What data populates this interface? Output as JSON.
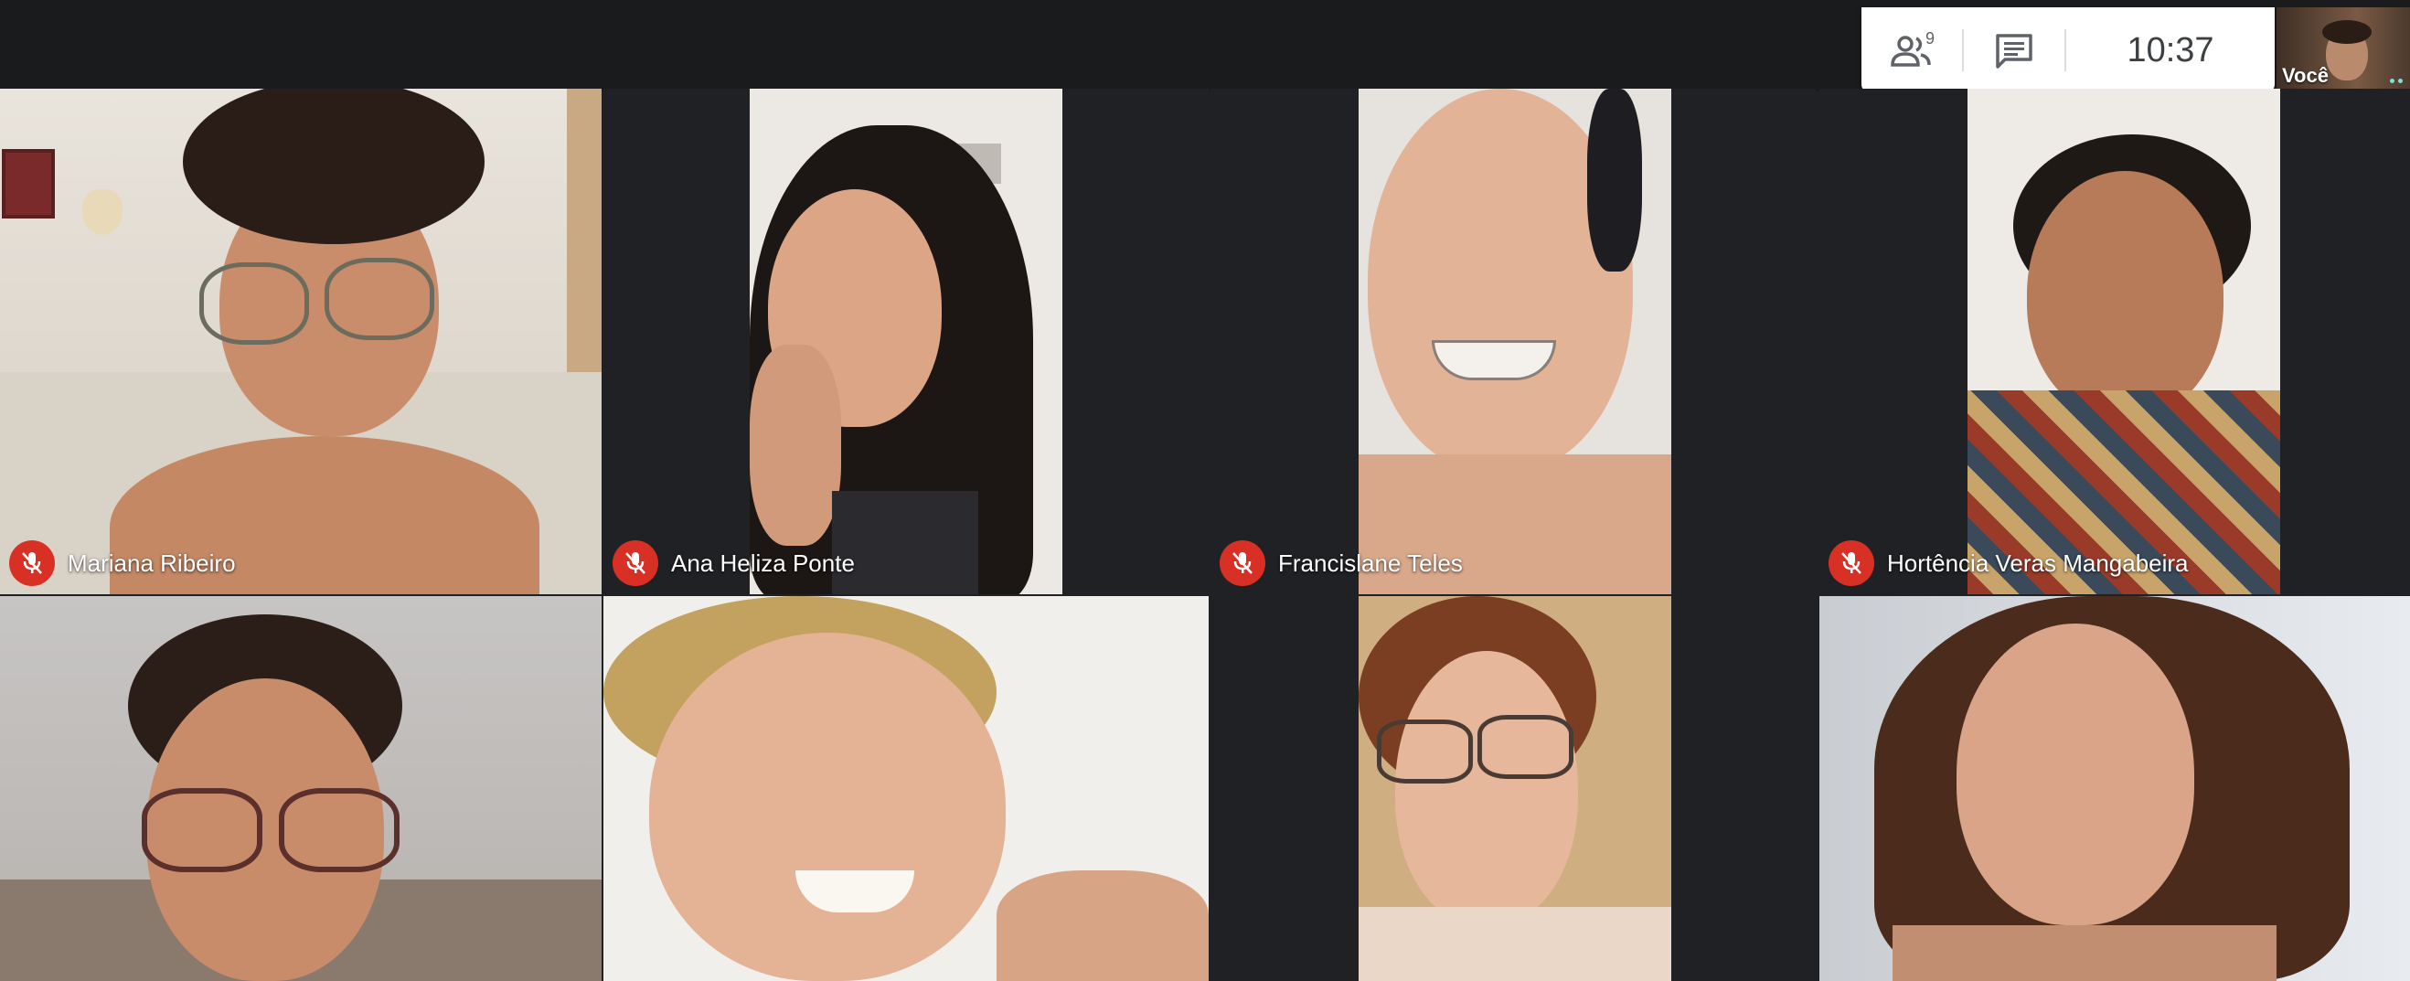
{
  "meeting": {
    "participant_count": "9",
    "time": "10:37",
    "self_label": "Você"
  },
  "participants": [
    {
      "name": "Mariana Ribeiro",
      "muted": true
    },
    {
      "name": "Ana Heliza Ponte",
      "muted": true
    },
    {
      "name": "Francislane Teles",
      "muted": true
    },
    {
      "name": "Hortência Veras Mangabeira",
      "muted": true
    },
    {
      "name": "",
      "muted": false
    },
    {
      "name": "",
      "muted": false
    },
    {
      "name": "",
      "muted": false
    },
    {
      "name": "",
      "muted": false
    }
  ],
  "icons": {
    "people": "people-icon",
    "chat": "chat-icon",
    "mic_off": "mic-off-icon"
  },
  "colors": {
    "muted_red": "#d93025",
    "background": "#202124",
    "panel": "#ffffff"
  }
}
